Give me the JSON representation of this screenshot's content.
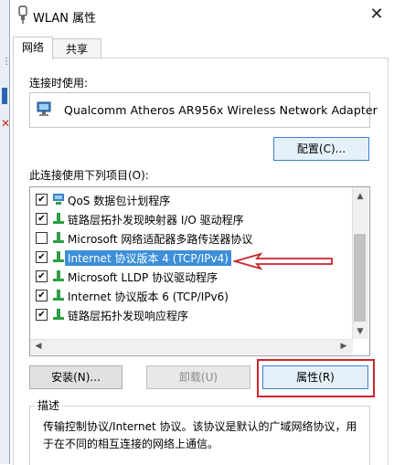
{
  "window": {
    "title": "WLAN 属性",
    "close_glyph": "✕"
  },
  "tabs": [
    {
      "label": "网络"
    },
    {
      "label": "共享"
    }
  ],
  "connect_using": {
    "label": "连接时使用:",
    "adapter": "Qualcomm Atheros AR956x Wireless Network Adapter"
  },
  "configure_button": "配置(C)...",
  "items_label": "此连接使用下列项目(O):",
  "items": [
    {
      "label": "QoS 数据包计划程序",
      "checked": true,
      "icon": "qos-icon"
    },
    {
      "label": "链路层拓扑发现映射器 I/O 驱动程序",
      "checked": true,
      "icon": "protocol-icon"
    },
    {
      "label": "Microsoft 网络适配器多路传送器协议",
      "checked": false,
      "icon": "protocol-icon"
    },
    {
      "label": "Internet 协议版本 4 (TCP/IPv4)",
      "checked": true,
      "icon": "protocol-icon",
      "selected": true
    },
    {
      "label": "Microsoft LLDP 协议驱动程序",
      "checked": true,
      "icon": "protocol-icon"
    },
    {
      "label": "Internet 协议版本 6 (TCP/IPv6)",
      "checked": true,
      "icon": "protocol-icon"
    },
    {
      "label": "链路层拓扑发现响应程序",
      "checked": true,
      "icon": "protocol-icon"
    }
  ],
  "buttons": {
    "install": "安装(N)...",
    "uninstall": "卸载(U)",
    "properties": "属性(R)"
  },
  "description": {
    "legend": "描述",
    "text": "传输控制协议/Internet 协议。该协议是默认的广域网络协议，用于在不同的相互连接的网络上通信。"
  },
  "colors": {
    "selection": "#3c8fd8",
    "annotation": "#c8252c",
    "accent": "#3c7fd3"
  }
}
